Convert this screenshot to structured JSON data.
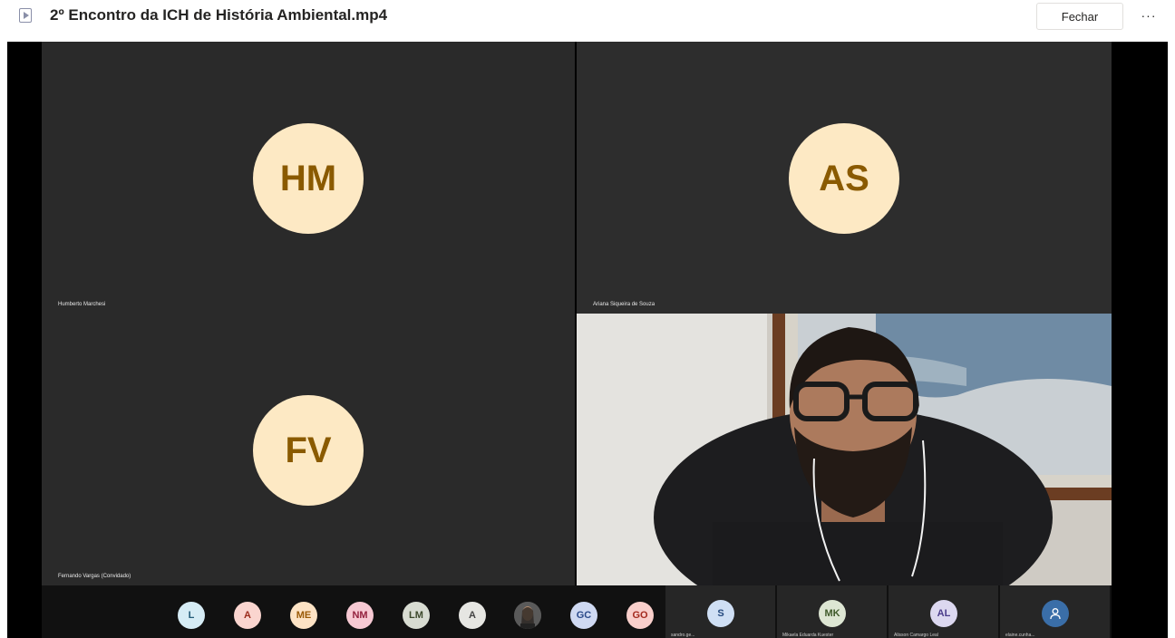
{
  "header": {
    "title": "2º Encontro da ICH de História Ambiental.mp4",
    "close_label": "Fechar",
    "more_label": "···"
  },
  "tiles": [
    {
      "initials": "HM",
      "name": "Humberto Marchesi"
    },
    {
      "initials": "AS",
      "name": "Ariana Siqueira de Souza"
    },
    {
      "initials": "FV",
      "name": "Fernando Vargas (Convidado)"
    }
  ],
  "strip_avatars": [
    {
      "initials": "L",
      "bg": "#d6ecf5",
      "fg": "#245c78"
    },
    {
      "initials": "A",
      "bg": "#fad5cf",
      "fg": "#9b2b1b"
    },
    {
      "initials": "ME",
      "bg": "#fde3c5",
      "fg": "#9a5a06"
    },
    {
      "initials": "NM",
      "bg": "#f7c9d3",
      "fg": "#93213e"
    },
    {
      "initials": "LM",
      "bg": "#d8dcd2",
      "fg": "#3d4a2c"
    },
    {
      "initials": "A",
      "bg": "#e6e6e2",
      "fg": "#444444"
    },
    {
      "initials": "",
      "bg": "#4a4a4a",
      "fg": "#ffffff"
    },
    {
      "initials": "GC",
      "bg": "#cfd9f2",
      "fg": "#2b4a8a"
    },
    {
      "initials": "GO",
      "bg": "#f9cfcb",
      "fg": "#a42a1e"
    }
  ],
  "strip_tiles": [
    {
      "initials": "S",
      "name": "sandro.ge...",
      "bg": "#cfdff4",
      "fg": "#23487d"
    },
    {
      "initials": "MK",
      "name": "Mikaela Eduarda Kuester",
      "bg": "#dde6d3",
      "fg": "#3f5a2a"
    },
    {
      "initials": "AL",
      "name": "Alisson Camargo Leal",
      "bg": "#dcd8f0",
      "fg": "#4a3c8a"
    },
    {
      "initials": "",
      "name": "elaine.cunha...",
      "bg": "#3a6ea8",
      "fg": "#ffffff"
    }
  ]
}
